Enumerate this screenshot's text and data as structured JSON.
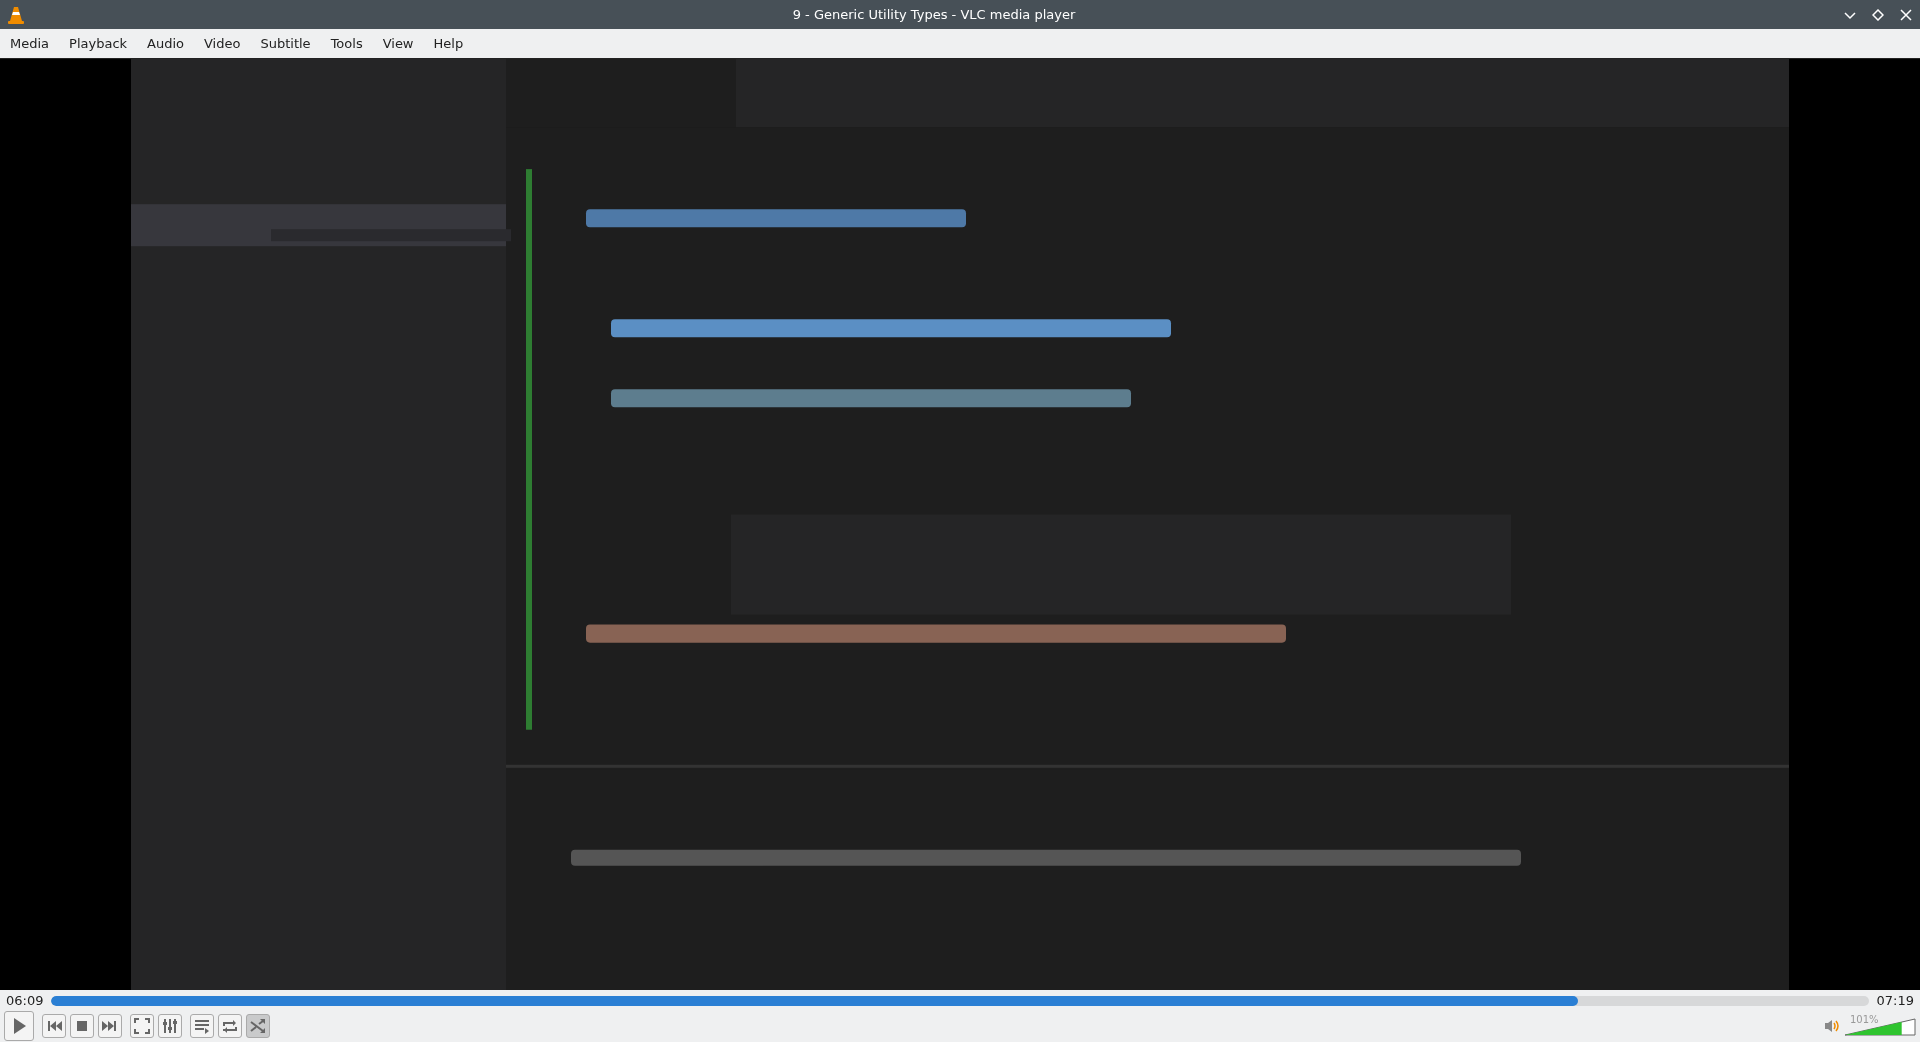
{
  "window": {
    "title": "9 - Generic Utility Types - VLC media player"
  },
  "menu": [
    "Media",
    "Playback",
    "Audio",
    "Video",
    "Subtitle",
    "Tools",
    "View",
    "Help"
  ],
  "video": {
    "kind": "picture"
  },
  "seek": {
    "elapsed": "06:09",
    "total": "07:19",
    "level": 0.84
  },
  "controls": [
    {
      "kind": "play"
    },
    {
      "kind": "previous"
    },
    {
      "kind": "stop"
    },
    {
      "kind": "next"
    },
    {
      "kind": "fullscreen"
    },
    {
      "kind": "settings"
    },
    {
      "kind": "playlist"
    },
    {
      "kind": "loop",
      "on": false
    },
    {
      "kind": "shuffle",
      "on": true
    }
  ],
  "volume": {
    "reading": "101%",
    "level": 0.81
  }
}
